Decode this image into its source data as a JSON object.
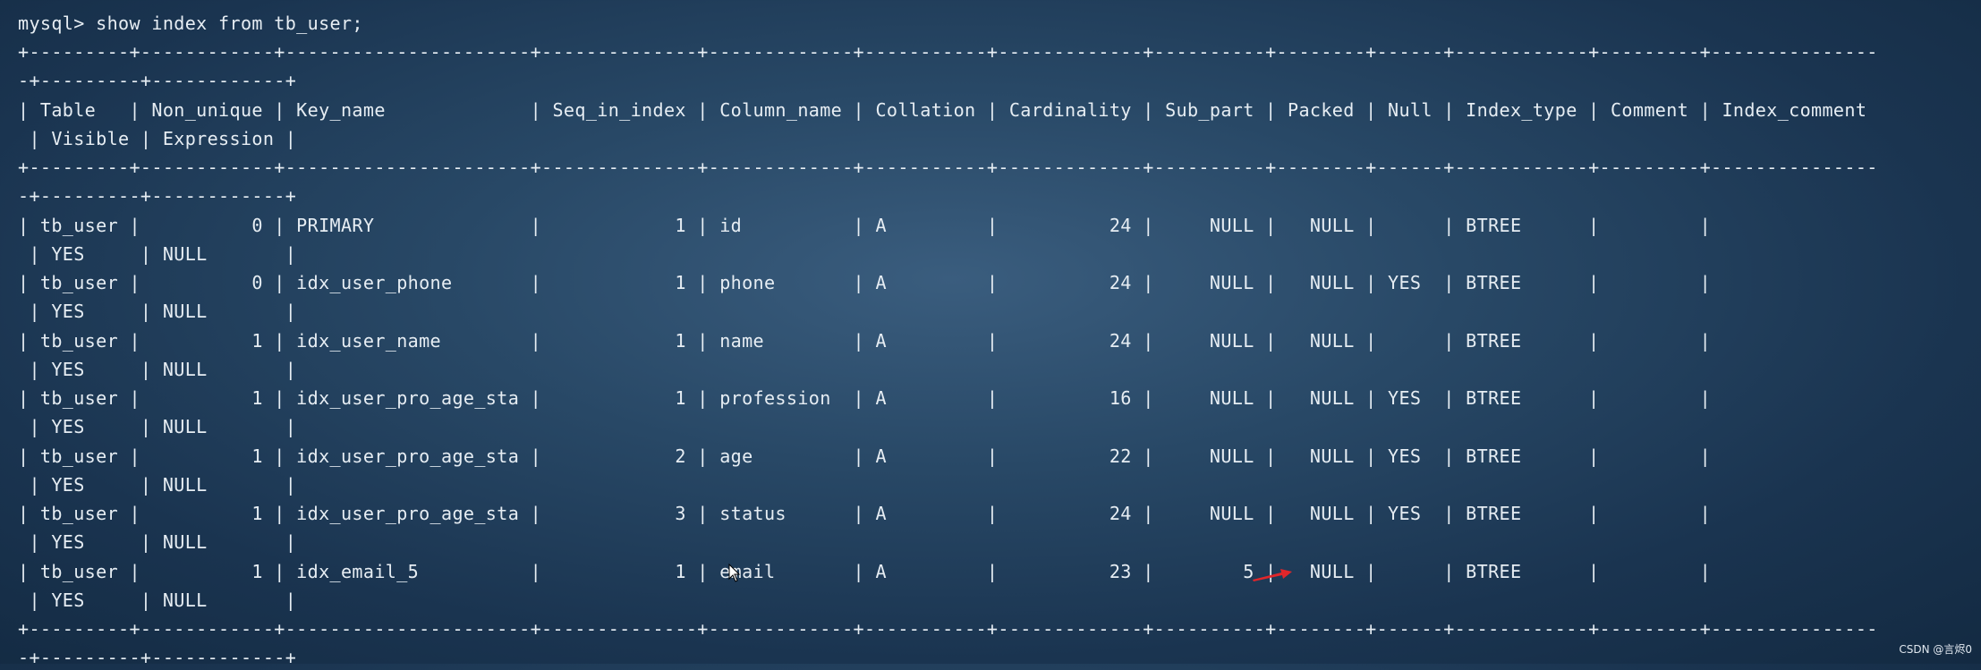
{
  "terminal": {
    "lines": [
      "mysql> show index from tb_user;",
      "+---------+------------+----------------------+--------------+-------------+-----------+-------------+----------+--------+------+------------+---------+---------------",
      "-+---------+------------+",
      "| Table   | Non_unique | Key_name             | Seq_in_index | Column_name | Collation | Cardinality | Sub_part | Packed | Null | Index_type | Comment | Index_comment",
      " | Visible | Expression |",
      "+---------+------------+----------------------+--------------+-------------+-----------+-------------+----------+--------+------+------------+---------+---------------",
      "-+---------+------------+",
      "| tb_user |          0 | PRIMARY              |            1 | id          | A         |          24 |     NULL |   NULL |      | BTREE      |         |",
      " | YES     | NULL       |",
      "| tb_user |          0 | idx_user_phone       |            1 | phone       | A         |          24 |     NULL |   NULL | YES  | BTREE      |         |",
      " | YES     | NULL       |",
      "| tb_user |          1 | idx_user_name        |            1 | name        | A         |          24 |     NULL |   NULL |      | BTREE      |         |",
      " | YES     | NULL       |",
      "| tb_user |          1 | idx_user_pro_age_sta |            1 | profession  | A         |          16 |     NULL |   NULL | YES  | BTREE      |         |",
      " | YES     | NULL       |",
      "| tb_user |          1 | idx_user_pro_age_sta |            2 | age         | A         |          22 |     NULL |   NULL | YES  | BTREE      |         |",
      " | YES     | NULL       |",
      "| tb_user |          1 | idx_user_pro_age_sta |            3 | status      | A         |          24 |     NULL |   NULL | YES  | BTREE      |         |",
      " | YES     | NULL       |",
      "| tb_user |          1 | idx_email_5          |            1 | email       | A         |          23 |        5 |   NULL |      | BTREE      |         |",
      " | YES     | NULL       |",
      "+---------+------------+----------------------+--------------+-------------+-----------+-------------+----------+--------+------+------------+---------+---------------",
      "-+---------+------------+"
    ]
  },
  "annotation": {
    "color": "#e0262a",
    "icon": "red-arrow-icon"
  },
  "watermark": "CSDN @言烬0"
}
